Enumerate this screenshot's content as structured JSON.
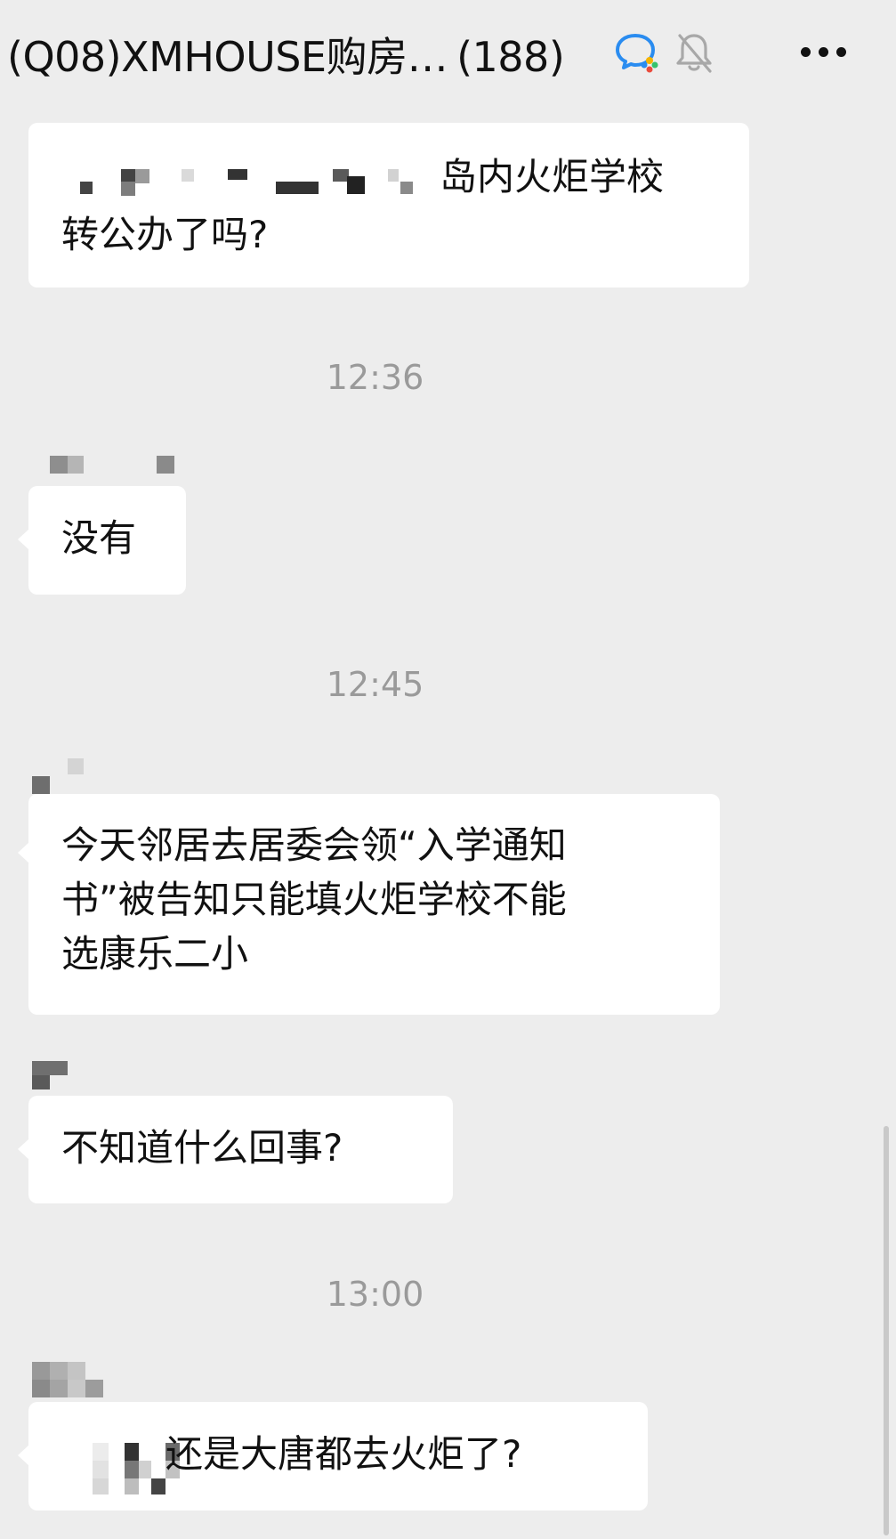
{
  "header": {
    "title": "(Q08)XMHOUSE购房…",
    "member_count": "(188)",
    "icons": [
      "wecom-chat-icon",
      "muted-bell-icon",
      "more-dots-icon"
    ]
  },
  "messages": [
    {
      "type": "text",
      "lines": [
        "岛内火炬学校",
        "转公办了吗?"
      ]
    },
    {
      "type": "time",
      "text": "12:36"
    },
    {
      "type": "text",
      "lines": [
        "没有"
      ]
    },
    {
      "type": "time",
      "text": "12:45"
    },
    {
      "type": "text",
      "lines": [
        "今天邻居去居委会领“入学通知",
        "书”被告知只能填火炬学校不能",
        "选康乐二小"
      ]
    },
    {
      "type": "text",
      "lines": [
        "不知道什么回事?"
      ]
    },
    {
      "type": "time",
      "text": "13:00"
    },
    {
      "type": "text",
      "lines": [
        "还是大唐都去火炬了?"
      ]
    }
  ],
  "colors": {
    "background": "#ededed",
    "bubble": "#ffffff",
    "timestamp": "#9a9a9a",
    "text": "#111111"
  }
}
